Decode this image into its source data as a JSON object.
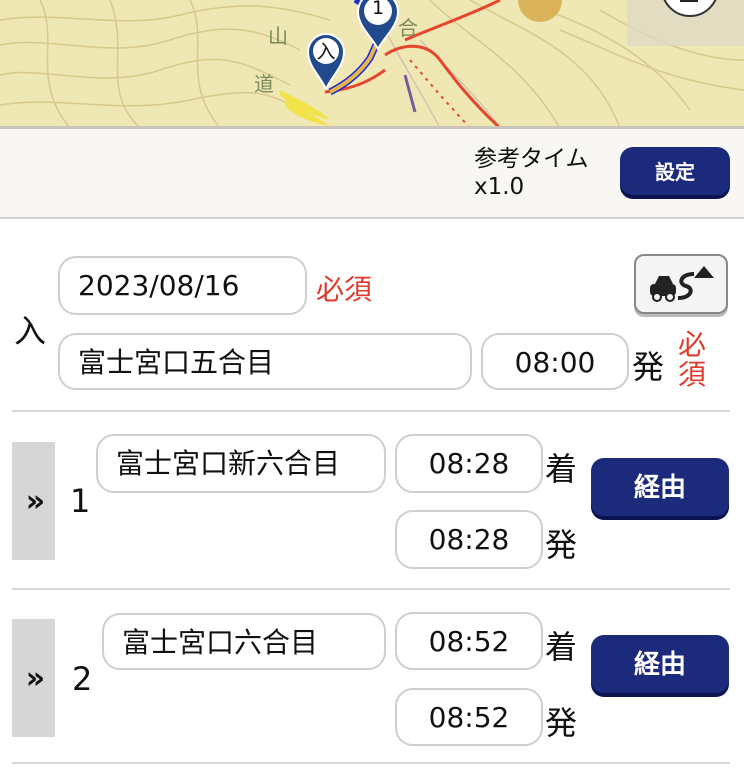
{
  "map": {
    "labels": {
      "yama": "山",
      "michi": "道",
      "ai": "合"
    },
    "markers": {
      "entry": "入",
      "waypoint_1": "1"
    },
    "colors": {
      "route_blue": "#1d2bd6",
      "route_gold": "#e7b64a",
      "trail_red": "#e5462e",
      "pin": "#214a8c"
    }
  },
  "toolbar": {
    "reference_time_label": "参考タイム",
    "reference_time_value": "x1.0",
    "settings_label": "設定"
  },
  "entry": {
    "side_label": "入",
    "date": "2023/08/16",
    "date_required": "必須",
    "place": "富士宮口五合目",
    "time": "08:00",
    "depart_label": "発",
    "time_required": "必須"
  },
  "waypoints": [
    {
      "index": "1",
      "place": "富士宮口新六合目",
      "arrive": "08:28",
      "depart": "08:28",
      "arrive_label": "着",
      "depart_label": "発",
      "via_label": "経由",
      "expander": "»"
    },
    {
      "index": "2",
      "place": "富士宮口六合目",
      "arrive": "08:52",
      "depart": "08:52",
      "arrive_label": "着",
      "depart_label": "発",
      "via_label": "経由",
      "expander": "»"
    }
  ],
  "colors": {
    "accent": "#1c2a7c",
    "required": "#e03a2c"
  }
}
